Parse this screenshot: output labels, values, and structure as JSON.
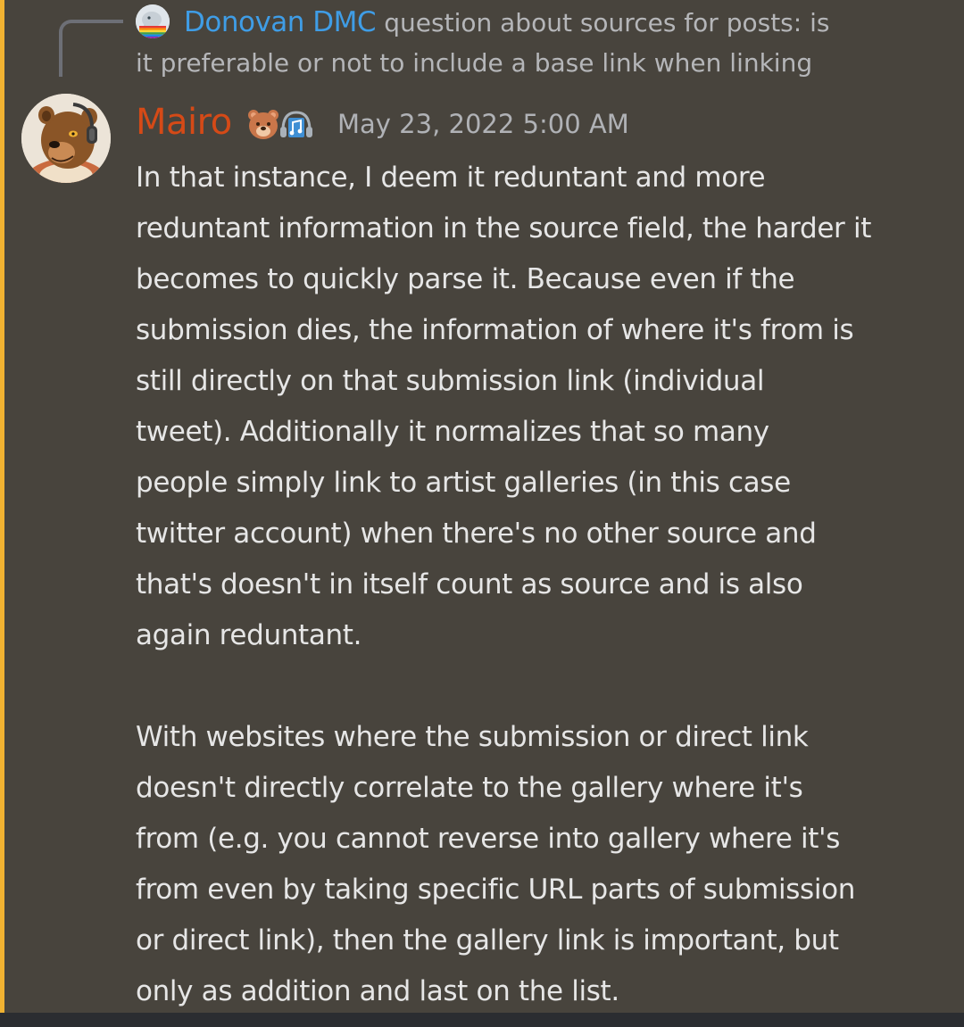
{
  "reply": {
    "author": "Donovan DMC",
    "text_line1": "question about sources for posts: is",
    "text_line2": "it preferable or not to include a base link when linking"
  },
  "message": {
    "author": "Mairo",
    "badges": [
      "bear-emoji",
      "music-note-emoji"
    ],
    "timestamp": "May 23, 2022 5:00 AM",
    "lines": [
      "In that instance, I deem it reduntant and more",
      "reduntant information in the source field, the harder it",
      "becomes to quickly parse it. Because even if the",
      "submission dies, the information of where it's from is",
      "still directly on that submission link (individual",
      "tweet). Additionally it normalizes that so many",
      "people simply link to artist galleries (in this case",
      "twitter account) when there's no other source and",
      "that's doesn't in itself count as source and is also",
      "again reduntant.",
      "",
      "With websites where the submission or direct link",
      "doesn't directly correlate to the gallery where it's",
      "from (e.g. you cannot reverse into gallery where it's",
      "from even by taking specific URL parts of submission",
      "or direct link), then the gallery link is important, but",
      "only as addition and last on the list."
    ]
  },
  "colors": {
    "background": "#48443d",
    "highlight_bar": "#f0b232",
    "reply_author": "#3f9de6",
    "username": "#d54a17",
    "body_text": "#e6e6e6",
    "muted_text": "#b5b6b9"
  }
}
